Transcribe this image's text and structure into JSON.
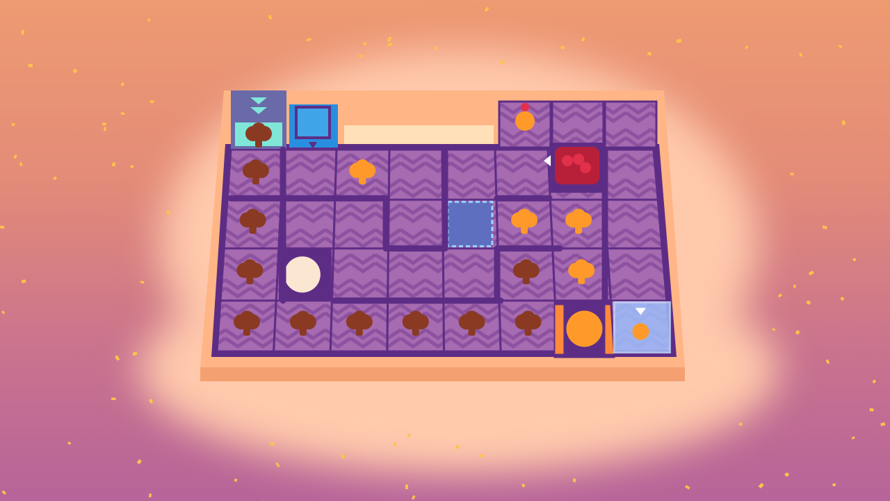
{
  "palette": {
    "sky_top": "#ee9a72",
    "sky_bottom": "#b7649a",
    "cloud": "#ffc9ac",
    "tray": "#ffb585",
    "tray_edge": "#f5a070",
    "tile": "#a66bb0",
    "tile_chevron": "#8c52a0",
    "wall": "#5d2d86",
    "cookie_raw": "#ff9a2a",
    "cookie_baked": "#8a3a22",
    "cream": "#fbe6d2",
    "icing_blue": "#3fa4e8",
    "cherry_red": "#e2304a",
    "teal": "#7fe6d8",
    "confetti": "#ffc24a"
  },
  "board": {
    "cols": 8,
    "rows": 5,
    "cells": [
      {
        "r": 0,
        "c": 0,
        "kind": "tile",
        "item": "baked"
      },
      {
        "r": 0,
        "c": 1,
        "kind": "tile",
        "item": "none"
      },
      {
        "r": 0,
        "c": 2,
        "kind": "tile",
        "item": "raw"
      },
      {
        "r": 0,
        "c": 3,
        "kind": "tile",
        "item": "none"
      },
      {
        "r": 0,
        "c": 4,
        "kind": "tile",
        "item": "none"
      },
      {
        "r": 0,
        "c": 5,
        "kind": "tile",
        "item": "none"
      },
      {
        "r": 0,
        "c": 6,
        "kind": "tile",
        "item": "none"
      },
      {
        "r": 0,
        "c": 7,
        "kind": "tile",
        "item": "none"
      },
      {
        "r": 1,
        "c": 0,
        "kind": "tile",
        "item": "baked"
      },
      {
        "r": 1,
        "c": 1,
        "kind": "tile",
        "item": "none"
      },
      {
        "r": 1,
        "c": 2,
        "kind": "tile",
        "item": "none"
      },
      {
        "r": 1,
        "c": 3,
        "kind": "tile",
        "item": "none"
      },
      {
        "r": 1,
        "c": 4,
        "kind": "switch-pad",
        "item": "none"
      },
      {
        "r": 1,
        "c": 5,
        "kind": "tile",
        "item": "raw"
      },
      {
        "r": 1,
        "c": 6,
        "kind": "tile",
        "item": "raw"
      },
      {
        "r": 1,
        "c": 7,
        "kind": "tile",
        "item": "none"
      },
      {
        "r": 2,
        "c": 0,
        "kind": "tile",
        "item": "baked"
      },
      {
        "r": 2,
        "c": 1,
        "kind": "cream-station",
        "item": "none"
      },
      {
        "r": 2,
        "c": 2,
        "kind": "tile",
        "item": "none"
      },
      {
        "r": 2,
        "c": 3,
        "kind": "tile",
        "item": "none"
      },
      {
        "r": 2,
        "c": 4,
        "kind": "tile",
        "item": "none"
      },
      {
        "r": 2,
        "c": 5,
        "kind": "tile",
        "item": "baked"
      },
      {
        "r": 2,
        "c": 6,
        "kind": "tile",
        "item": "raw"
      },
      {
        "r": 2,
        "c": 7,
        "kind": "tile",
        "item": "none"
      },
      {
        "r": 3,
        "c": 0,
        "kind": "tile",
        "item": "baked"
      },
      {
        "r": 3,
        "c": 1,
        "kind": "tile",
        "item": "baked"
      },
      {
        "r": 3,
        "c": 2,
        "kind": "tile",
        "item": "baked"
      },
      {
        "r": 3,
        "c": 3,
        "kind": "tile",
        "item": "baked"
      },
      {
        "r": 3,
        "c": 4,
        "kind": "tile",
        "item": "baked"
      },
      {
        "r": 3,
        "c": 5,
        "kind": "tile",
        "item": "baked"
      },
      {
        "r": 3,
        "c": 6,
        "kind": "oven",
        "item": "none"
      },
      {
        "r": 3,
        "c": 7,
        "kind": "exit-box",
        "item": "finished"
      }
    ],
    "top_row": [
      {
        "c": 0,
        "kind": "entry-box"
      },
      {
        "c": 1,
        "kind": "sprinkle-station"
      },
      {
        "c": 5,
        "kind": "tile-decorated"
      },
      {
        "c": 6,
        "kind": "tile"
      },
      {
        "c": 7,
        "kind": "tile"
      }
    ],
    "special": {
      "cherry_station": {
        "r": 0,
        "c": 6
      }
    }
  }
}
